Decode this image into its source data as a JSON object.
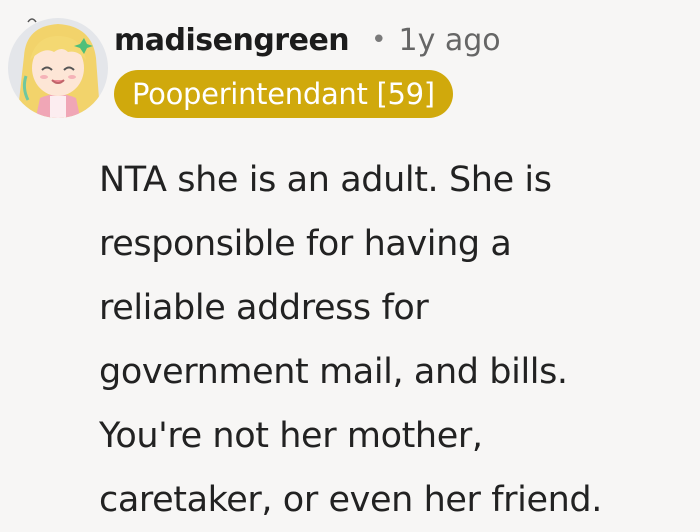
{
  "comment": {
    "username": "madisengreen",
    "separator": "•",
    "timestamp": "1y ago",
    "flair": "Pooperintendant [59]",
    "body_lines": [
      "NTA she is an adult. She is",
      "responsible for having a",
      "reliable address for",
      "government mail, and bills.",
      "You're not her mother,",
      "caretaker, or even her friend."
    ]
  },
  "colors": {
    "background": "#f7f6f5",
    "flair_bg": "#d0a90c",
    "flair_text": "#ffffff",
    "username": "#1c1c1c",
    "timestamp": "#666666",
    "body_text": "#222222"
  },
  "icons": {
    "avatar": "avatar-illustration-blonde-character"
  }
}
